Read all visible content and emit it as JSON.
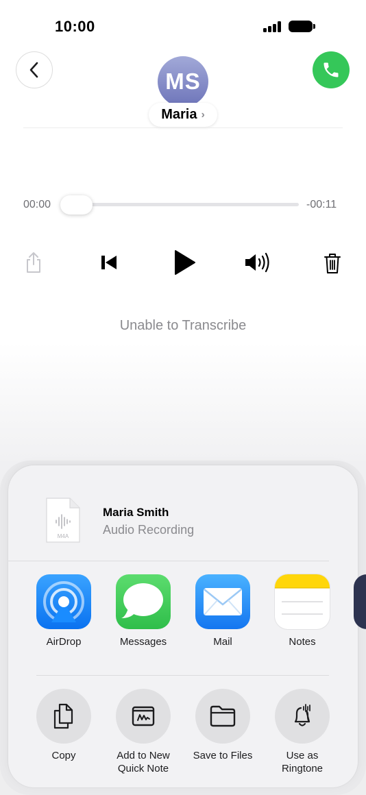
{
  "status_bar": {
    "time": "10:00"
  },
  "header": {
    "avatar_initials": "MS",
    "contact_name": "Maria",
    "chevron": "›"
  },
  "player": {
    "time_elapsed": "00:00",
    "time_remaining": "-00:11",
    "progress": 0,
    "transcription_status": "Unable to Transcribe"
  },
  "share_sheet": {
    "file": {
      "title": "Maria Smith",
      "subtitle": "Audio Recording",
      "badge": "M4A"
    },
    "apps": [
      {
        "label": "AirDrop",
        "icon": "airdrop-icon",
        "color": "#1a8cff"
      },
      {
        "label": "Messages",
        "icon": "messages-icon",
        "color": "#34c759"
      },
      {
        "label": "Mail",
        "icon": "mail-icon",
        "color": "#1a8cff"
      },
      {
        "label": "Notes",
        "icon": "notes-icon",
        "color": "#ffd60a"
      }
    ],
    "actions": [
      {
        "label": "Copy",
        "icon": "copy-icon"
      },
      {
        "label": "Add to New\nQuick Note",
        "icon": "quick-note-icon"
      },
      {
        "label": "Save to Files",
        "icon": "folder-icon"
      },
      {
        "label": "Use as\nRingtone",
        "icon": "bell-icon"
      }
    ]
  },
  "colors": {
    "call_green": "#35c759",
    "avatar_top": "#a2a9d8",
    "avatar_bottom": "#6d74b9"
  }
}
